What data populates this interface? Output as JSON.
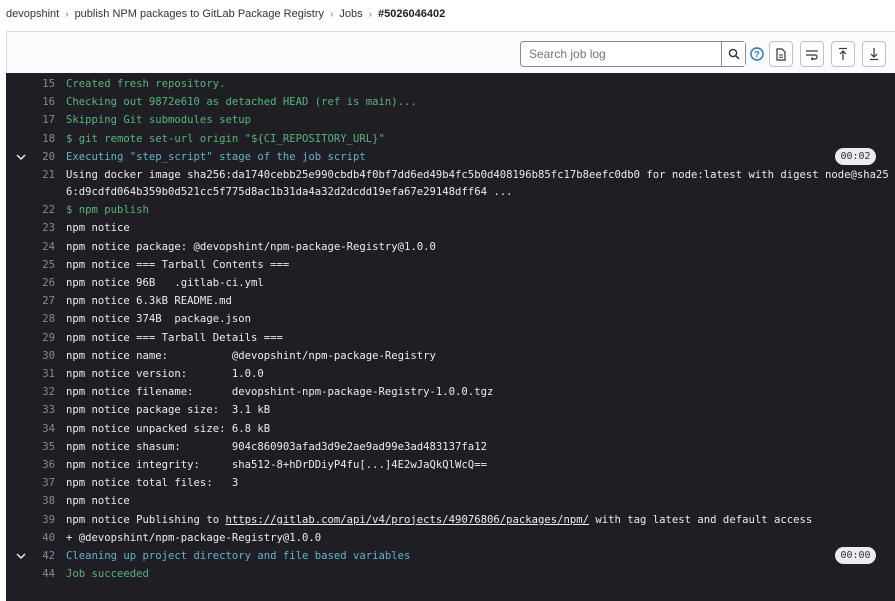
{
  "breadcrumb": {
    "items": [
      "devopshint",
      "publish NPM packages to GitLab Package Registry",
      "Jobs",
      "#5026046402"
    ]
  },
  "toolbar": {
    "search_placeholder": "Search job log",
    "icons": [
      "search-icon",
      "help-icon",
      "raw-file-icon",
      "wrap-icon",
      "scroll-top-icon",
      "scroll-bottom-icon"
    ]
  },
  "log": {
    "lines": [
      {
        "num": "15",
        "text": "Created fresh repository.",
        "color": "green"
      },
      {
        "num": "16",
        "text": "Checking out 9872e610 as detached HEAD (ref is main)...",
        "color": "green"
      },
      {
        "num": "17",
        "text": "Skipping Git submodules setup",
        "color": "green"
      },
      {
        "num": "18",
        "text": "$ git remote set-url origin \"${CI_REPOSITORY_URL}\"",
        "color": "green"
      },
      {
        "num": "20",
        "text": "Executing \"step_script\" stage of the job script",
        "color": "cyan",
        "section": true,
        "duration": "00:02"
      },
      {
        "num": "21",
        "text": "Using docker image sha256:da1740cebb25e990cbdb4f0bf7dd6ed49b4fc5b0d408196b85fc17b8eefc0db0 for node:latest with digest node@sha25",
        "text2": "6:d9cdfd064b359b0d521cc5f775d8ac1b31da4a32d2dcdd19efa67e29148dff64 ...",
        "color": "default"
      },
      {
        "num": "22",
        "text": "$ npm publish",
        "color": "green"
      },
      {
        "num": "23",
        "text": "npm notice",
        "color": "default"
      },
      {
        "num": "24",
        "text": "npm notice package: @devopshint/npm-package-Registry@1.0.0",
        "color": "default"
      },
      {
        "num": "25",
        "text": "npm notice === Tarball Contents ===",
        "color": "default"
      },
      {
        "num": "26",
        "text": "npm notice 96B   .gitlab-ci.yml",
        "color": "default"
      },
      {
        "num": "27",
        "text": "npm notice 6.3kB README.md",
        "color": "default"
      },
      {
        "num": "28",
        "text": "npm notice 374B  package.json",
        "color": "default"
      },
      {
        "num": "29",
        "text": "npm notice === Tarball Details ===",
        "color": "default"
      },
      {
        "num": "30",
        "text": "npm notice name:          @devopshint/npm-package-Registry",
        "color": "default"
      },
      {
        "num": "31",
        "text": "npm notice version:       1.0.0",
        "color": "default"
      },
      {
        "num": "32",
        "text": "npm notice filename:      devopshint-npm-package-Registry-1.0.0.tgz",
        "color": "default"
      },
      {
        "num": "33",
        "text": "npm notice package size:  3.1 kB",
        "color": "default"
      },
      {
        "num": "34",
        "text": "npm notice unpacked size: 6.8 kB",
        "color": "default"
      },
      {
        "num": "35",
        "text": "npm notice shasum:        904c860903afad3d9e2ae9ad99e3ad483137fa12",
        "color": "default"
      },
      {
        "num": "36",
        "text": "npm notice integrity:     sha512-8+hDrDDiyP4fu[...]4E2wJaQkQlWcQ==",
        "color": "default"
      },
      {
        "num": "37",
        "text": "npm notice total files:   3",
        "color": "default"
      },
      {
        "num": "38",
        "text": "npm notice",
        "color": "default"
      },
      {
        "num": "39",
        "text": "npm notice Publishing to ",
        "link": "https://gitlab.com/api/v4/projects/49076806/packages/npm/",
        "suffix": " with tag latest and default access",
        "color": "default"
      },
      {
        "num": "40",
        "text": "+ @devopshint/npm-package-Registry@1.0.0",
        "color": "default"
      },
      {
        "num": "42",
        "text": "Cleaning up project directory and file based variables",
        "color": "cyan",
        "section": true,
        "duration": "00:00"
      },
      {
        "num": "44",
        "text": "Job succeeded",
        "color": "green"
      }
    ]
  }
}
